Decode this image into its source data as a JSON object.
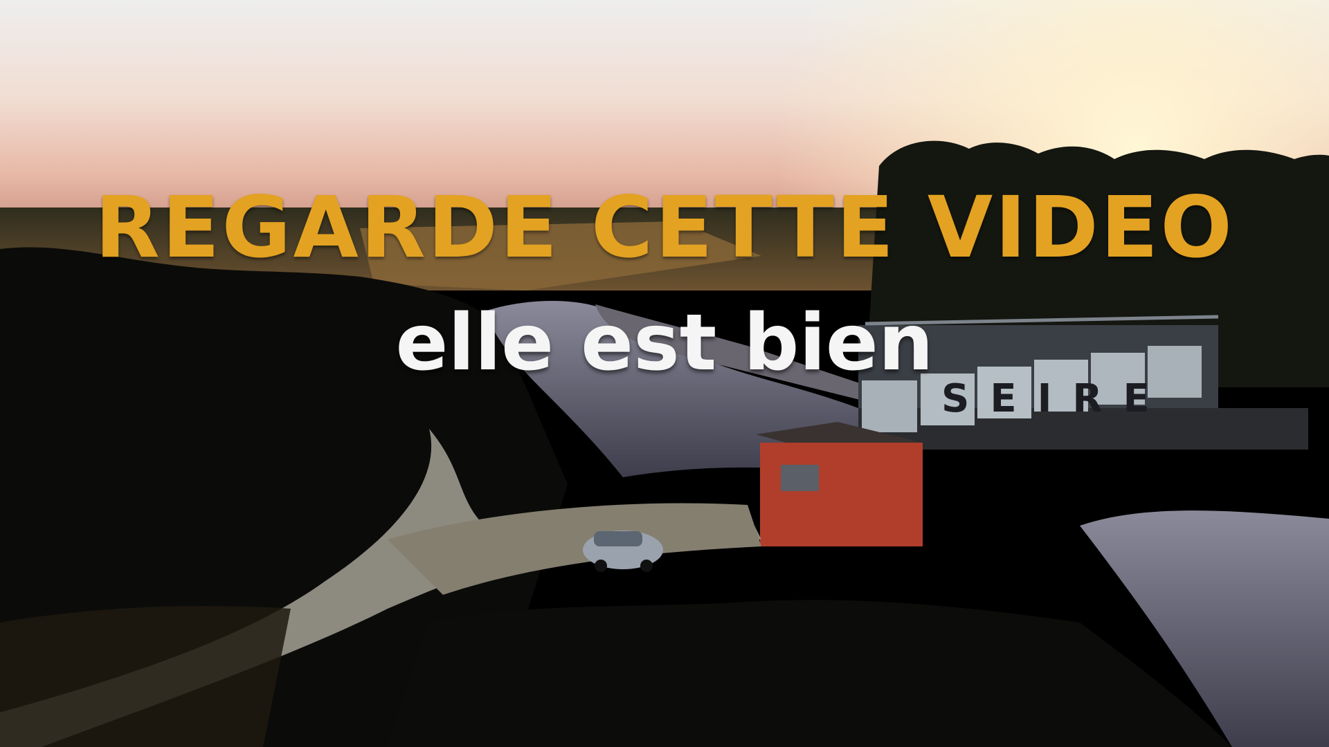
{
  "overlay": {
    "headline": "REGARDE CETTE VIDEO",
    "subline": "elle est bien",
    "headline_color": "#e3a221",
    "subline_color": "#f5f5f5"
  },
  "scene": {
    "graffiti_text": "SEIRE",
    "palette": {
      "sky_top": "#f4efef",
      "sky_horizon": "#e2b8a8",
      "sun_glow": "#fff6d8",
      "foliage": "#0d0f0a",
      "water": "#5b5a6c",
      "building": "#b5402c"
    }
  }
}
